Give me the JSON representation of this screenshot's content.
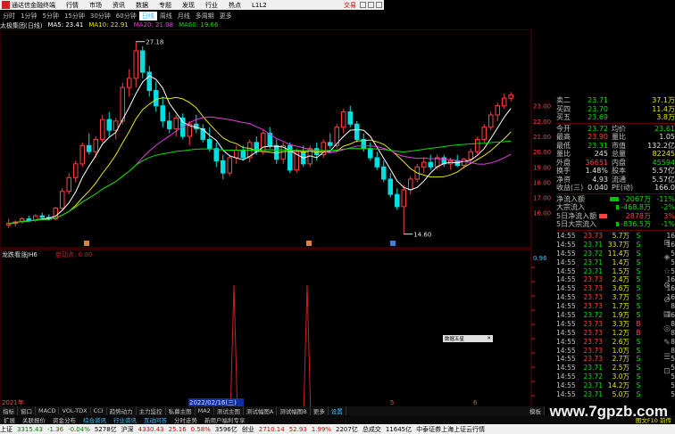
{
  "app": {
    "title": "通达信金融终端",
    "menu": [
      "行情",
      "市场",
      "资讯",
      "数据",
      "专题",
      "发现",
      "行业",
      "热点",
      "L1L2"
    ],
    "trade_label": "交易"
  },
  "periods": [
    {
      "label": "分时",
      "active": false
    },
    {
      "label": "1分钟",
      "active": false
    },
    {
      "label": "5分钟",
      "active": false
    },
    {
      "label": "15分钟",
      "active": false
    },
    {
      "label": "30分钟",
      "active": false
    },
    {
      "label": "60分钟",
      "active": false
    },
    {
      "label": "日线",
      "active": true
    },
    {
      "label": "周线",
      "active": false
    },
    {
      "label": "月线",
      "active": false
    },
    {
      "label": "多周期",
      "active": false
    },
    {
      "label": "更多",
      "active": false
    }
  ],
  "main_info": {
    "stock": "太极集团(日线)",
    "ma5": "MA5: 23.41",
    "ma10": "MA10: 22.91",
    "ma20": "MA20: 21.08",
    "ma60": "MA60: 19.66"
  },
  "colors": {
    "up": "#ff4040",
    "down": "#00e0e0",
    "ma5": "#ffffff",
    "ma10": "#e8e800",
    "ma20": "#e040e0",
    "ma60": "#00e000",
    "indicator": "#d02020"
  },
  "price_axis": [
    "23.00",
    "22.00",
    "21.00",
    "20.00",
    "19.00",
    "18.00",
    "17.00",
    "16.00"
  ],
  "high_marker": "27.18",
  "low_marker": "14.60",
  "indicator": {
    "name": "龙跌看涨JH6",
    "value_label": "启动点: 0.00",
    "axis_value": "0.96"
  },
  "date_labels": [
    "2021年",
    "2022/02/16(三)",
    "5",
    "6"
  ],
  "popup": {
    "label": "数据五星"
  },
  "quote": [
    {
      "label": "卖二",
      "price": "23.71",
      "vol": "37.1万",
      "price_class": "green"
    },
    {
      "label": "买四",
      "price": "23.70",
      "vol": "11.4万",
      "price_class": "green"
    },
    {
      "label": "买五",
      "price": "23.69",
      "vol": "3.8万",
      "price_class": "green"
    }
  ],
  "stats": [
    {
      "l1": "今开",
      "v1": "23.72",
      "c1": "green",
      "l2": "均价",
      "v2": "23.61",
      "c2": "green"
    },
    {
      "l1": "最高",
      "v1": "23.90",
      "c1": "red",
      "l2": "量比",
      "v2": "1.05",
      "c2": "white"
    },
    {
      "l1": "最低",
      "v1": "23.31",
      "c1": "green",
      "l2": "市值",
      "v2": "132.2亿",
      "c2": "white"
    },
    {
      "l1": "量比",
      "v1": "245",
      "c1": "white",
      "l2": "总量",
      "v2": "82245",
      "c2": "yellow"
    },
    {
      "l1": "外盘",
      "v1": "36651",
      "c1": "red",
      "l2": "内盘",
      "v2": "45594",
      "c2": "green"
    },
    {
      "l1": "换手",
      "v1": "1.48%",
      "c1": "white",
      "l2": "股本",
      "v2": "5.57亿",
      "c2": "white"
    },
    {
      "l1": "净资",
      "v1": "4.93",
      "c1": "white",
      "l2": "流通",
      "v2": "5.57亿",
      "c2": "white"
    },
    {
      "l1": "收益(三)",
      "v1": "0.040",
      "c1": "white",
      "l2": "PE(动)",
      "v2": "166.0",
      "c2": "white"
    }
  ],
  "flows": [
    {
      "label": "净流入额",
      "value": "-2067万",
      "pct": "-11%",
      "cls": "green",
      "bar": -0.45
    },
    {
      "label": "大宗流入",
      "value": "-468.8万",
      "pct": "-2%",
      "cls": "green",
      "bar": -0.15
    },
    {
      "label": "5日净流入额",
      "value": "2878万",
      "pct": "3%",
      "cls": "red",
      "bar": 0.4
    },
    {
      "label": "5日大宗流入",
      "value": "-836.5万",
      "pct": "-1%",
      "cls": "green",
      "bar": -0.15
    }
  ],
  "ticks": [
    {
      "t": "14:55",
      "p": "23.73",
      "pc": "red",
      "v": "5.7万",
      "bs": "S",
      "bsc": "green",
      "n": "16"
    },
    {
      "t": "14:55",
      "p": "23.71",
      "pc": "green",
      "v": "33.7万",
      "bs": "S",
      "bsc": "green",
      "n": "16"
    },
    {
      "t": "14:55",
      "p": "23.72",
      "pc": "green",
      "v": "11.4万",
      "bs": "S",
      "bsc": "green",
      "n": "5"
    },
    {
      "t": "14:55",
      "p": "23.71",
      "pc": "green",
      "v": "1.4万",
      "bs": "S",
      "bsc": "green",
      "n": "5"
    },
    {
      "t": "14:55",
      "p": "23.71",
      "pc": "green",
      "v": "1.5万",
      "bs": "S",
      "bsc": "green",
      "n": "5"
    },
    {
      "t": "14:55",
      "p": "23.73",
      "pc": "red",
      "v": "2.4万",
      "bs": "S",
      "bsc": "green",
      "n": "16"
    },
    {
      "t": "14:55",
      "p": "23.73",
      "pc": "red",
      "v": "3.6万",
      "bs": "S",
      "bsc": "green",
      "n": "16"
    },
    {
      "t": "14:55",
      "p": "23.73",
      "pc": "red",
      "v": "3.7万",
      "bs": "S",
      "bsc": "green",
      "n": "16"
    },
    {
      "t": "14:55",
      "p": "23.73",
      "pc": "red",
      "v": "1.7万",
      "bs": "S",
      "bsc": "green",
      "n": "8"
    },
    {
      "t": "14:55",
      "p": "23.72",
      "pc": "green",
      "v": "1.9万",
      "bs": "S",
      "bsc": "green",
      "n": "16"
    },
    {
      "t": "14:55",
      "p": "23.73",
      "pc": "red",
      "v": "3.3万",
      "bs": "B",
      "bsc": "red",
      "n": "8"
    },
    {
      "t": "14:55",
      "p": "23.73",
      "pc": "red",
      "v": "1.2万",
      "bs": "B",
      "bsc": "red",
      "n": "8"
    },
    {
      "t": "14:55",
      "p": "23.73",
      "pc": "red",
      "v": "2.6万",
      "bs": "S",
      "bsc": "green",
      "n": "8"
    },
    {
      "t": "14:55",
      "p": "23.73",
      "pc": "red",
      "v": "1.0万",
      "bs": "S",
      "bsc": "green",
      "n": "8"
    },
    {
      "t": "14:55",
      "p": "23.73",
      "pc": "red",
      "v": "2.7万",
      "bs": "S",
      "bsc": "green",
      "n": "5"
    },
    {
      "t": "14:55",
      "p": "23.71",
      "pc": "green",
      "v": "2.5万",
      "bs": "S",
      "bsc": "green",
      "n": "5"
    },
    {
      "t": "14:55",
      "p": "23.72",
      "pc": "green",
      "v": "3.0万",
      "bs": "S",
      "bsc": "green",
      "n": "5"
    },
    {
      "t": "14:55",
      "p": "23.71",
      "pc": "green",
      "v": "14.2万",
      "bs": "S",
      "bsc": "green",
      "n": "5"
    },
    {
      "t": "14:55",
      "p": "23.71",
      "pc": "green",
      "v": "5.0万",
      "bs": "S",
      "bsc": "green",
      "n": "5"
    }
  ],
  "tabs": [
    "指标",
    "窗口",
    "MACD",
    "VOL-TDX",
    "CCI",
    "趋势动力",
    "主力监控",
    "私募主图",
    "MA2",
    "测试主图",
    "测试幅图A",
    "测试幅图B",
    "更多",
    "设置"
  ],
  "tab_right": "模板",
  "extbar": [
    "扩展",
    "关联报价",
    "资金分布",
    "综合资讯",
    "行业资讯",
    "互动问答",
    "分时走势",
    "新用户福利专享"
  ],
  "extbar_right": "图文F10 前传",
  "status": [
    {
      "text": "上证",
      "cls": ""
    },
    {
      "text": "3315.43",
      "cls": "g"
    },
    {
      "text": "-1.36",
      "cls": "g"
    },
    {
      "text": "-0.04%",
      "cls": "g"
    },
    {
      "text": "5278亿",
      "cls": ""
    },
    {
      "text": "沪深",
      "cls": ""
    },
    {
      "text": "4330.43",
      "cls": "r"
    },
    {
      "text": "25.16",
      "cls": "r"
    },
    {
      "text": "0.58%",
      "cls": "r"
    },
    {
      "text": "3596亿",
      "cls": ""
    },
    {
      "text": "创业",
      "cls": ""
    },
    {
      "text": "2710.14",
      "cls": "r"
    },
    {
      "text": "52.93",
      "cls": "r"
    },
    {
      "text": "1.99%",
      "cls": "r"
    },
    {
      "text": "2207亿",
      "cls": ""
    },
    {
      "text": "总成交",
      "cls": ""
    },
    {
      "text": "11645亿",
      "cls": ""
    },
    {
      "text": "中泰证券上海上证云行情",
      "cls": ""
    }
  ],
  "watermark": "www.7gpzb.com",
  "chart_data": {
    "type": "candlestick",
    "ylim": [
      14.0,
      28.0
    ],
    "candles": [
      [
        15.2,
        15.6,
        15.0,
        15.3
      ],
      [
        15.3,
        15.5,
        15.1,
        15.4
      ],
      [
        15.4,
        15.7,
        15.3,
        15.6
      ],
      [
        15.6,
        15.8,
        15.4,
        15.5
      ],
      [
        15.5,
        15.9,
        15.4,
        15.8
      ],
      [
        15.8,
        16.0,
        15.6,
        15.7
      ],
      [
        15.7,
        15.9,
        15.5,
        15.6
      ],
      [
        15.6,
        16.4,
        15.5,
        16.3
      ],
      [
        16.3,
        17.6,
        16.2,
        17.4
      ],
      [
        17.4,
        18.6,
        17.2,
        18.3
      ],
      [
        18.3,
        19.4,
        18.0,
        19.2
      ],
      [
        19.2,
        20.6,
        19.0,
        20.4
      ],
      [
        20.4,
        21.2,
        19.8,
        20.0
      ],
      [
        20.0,
        21.0,
        19.6,
        20.8
      ],
      [
        20.8,
        22.4,
        20.6,
        22.1
      ],
      [
        22.1,
        22.6,
        21.0,
        21.4
      ],
      [
        21.4,
        22.2,
        20.8,
        22.0
      ],
      [
        22.0,
        24.5,
        21.8,
        24.2
      ],
      [
        24.2,
        25.4,
        23.6,
        24.8
      ],
      [
        24.8,
        27.2,
        24.2,
        26.6
      ],
      [
        26.6,
        26.9,
        24.8,
        25.2
      ],
      [
        25.2,
        25.6,
        23.6,
        24.0
      ],
      [
        24.0,
        24.6,
        22.6,
        23.0
      ],
      [
        23.0,
        23.6,
        21.6,
        22.0
      ],
      [
        22.0,
        22.6,
        21.2,
        21.5
      ],
      [
        21.5,
        22.4,
        21.0,
        22.2
      ],
      [
        22.2,
        22.5,
        20.8,
        21.0
      ],
      [
        21.0,
        22.0,
        20.4,
        21.8
      ],
      [
        21.8,
        22.4,
        21.2,
        21.5
      ],
      [
        21.5,
        21.8,
        20.6,
        20.8
      ],
      [
        20.8,
        21.6,
        20.0,
        20.2
      ],
      [
        20.2,
        20.6,
        19.0,
        19.4
      ],
      [
        19.4,
        19.8,
        18.2,
        18.6
      ],
      [
        18.6,
        19.8,
        18.4,
        19.6
      ],
      [
        19.6,
        20.4,
        19.2,
        20.1
      ],
      [
        20.1,
        20.4,
        19.4,
        19.6
      ],
      [
        19.6,
        20.8,
        19.3,
        20.6
      ],
      [
        20.6,
        21.0,
        19.8,
        20.0
      ],
      [
        20.0,
        21.4,
        19.8,
        21.2
      ],
      [
        21.2,
        21.6,
        20.2,
        20.4
      ],
      [
        20.4,
        20.8,
        19.2,
        19.5
      ],
      [
        19.5,
        20.6,
        19.2,
        20.4
      ],
      [
        20.4,
        20.6,
        18.6,
        18.8
      ],
      [
        18.8,
        20.2,
        18.6,
        20.0
      ],
      [
        20.0,
        20.4,
        19.0,
        19.2
      ],
      [
        19.2,
        20.4,
        19.0,
        20.2
      ],
      [
        20.2,
        20.6,
        19.4,
        19.8
      ],
      [
        19.8,
        20.8,
        19.6,
        20.6
      ],
      [
        20.6,
        21.2,
        20.2,
        20.4
      ],
      [
        20.4,
        21.8,
        20.2,
        21.6
      ],
      [
        21.6,
        22.8,
        21.2,
        22.6
      ],
      [
        22.6,
        23.0,
        21.6,
        21.8
      ],
      [
        21.8,
        22.0,
        20.6,
        20.8
      ],
      [
        20.8,
        21.2,
        20.0,
        20.2
      ],
      [
        20.2,
        20.6,
        19.4,
        19.6
      ],
      [
        19.6,
        20.0,
        18.8,
        19.0
      ],
      [
        19.0,
        19.4,
        18.0,
        18.2
      ],
      [
        18.2,
        18.6,
        17.0,
        17.2
      ],
      [
        17.2,
        17.6,
        16.2,
        16.4
      ],
      [
        16.4,
        17.8,
        14.6,
        17.5
      ],
      [
        17.5,
        18.4,
        17.2,
        18.2
      ],
      [
        18.2,
        19.2,
        18.0,
        19.0
      ],
      [
        19.0,
        19.6,
        18.6,
        19.3
      ],
      [
        19.3,
        19.8,
        18.8,
        19.0
      ],
      [
        19.0,
        19.8,
        18.8,
        19.6
      ],
      [
        19.6,
        19.8,
        19.0,
        19.2
      ],
      [
        19.2,
        19.6,
        18.8,
        19.4
      ],
      [
        19.4,
        19.8,
        19.0,
        19.1
      ],
      [
        19.1,
        19.6,
        18.9,
        19.5
      ],
      [
        19.5,
        20.2,
        19.3,
        20.0
      ],
      [
        20.0,
        21.0,
        19.8,
        20.8
      ],
      [
        20.8,
        21.8,
        20.6,
        21.6
      ],
      [
        21.6,
        22.6,
        21.4,
        22.4
      ],
      [
        22.4,
        23.2,
        22.0,
        23.0
      ],
      [
        23.0,
        23.8,
        22.8,
        23.5
      ],
      [
        23.5,
        23.9,
        23.3,
        23.7
      ]
    ],
    "indicator_spikes_at": [
      28,
      37
    ]
  }
}
